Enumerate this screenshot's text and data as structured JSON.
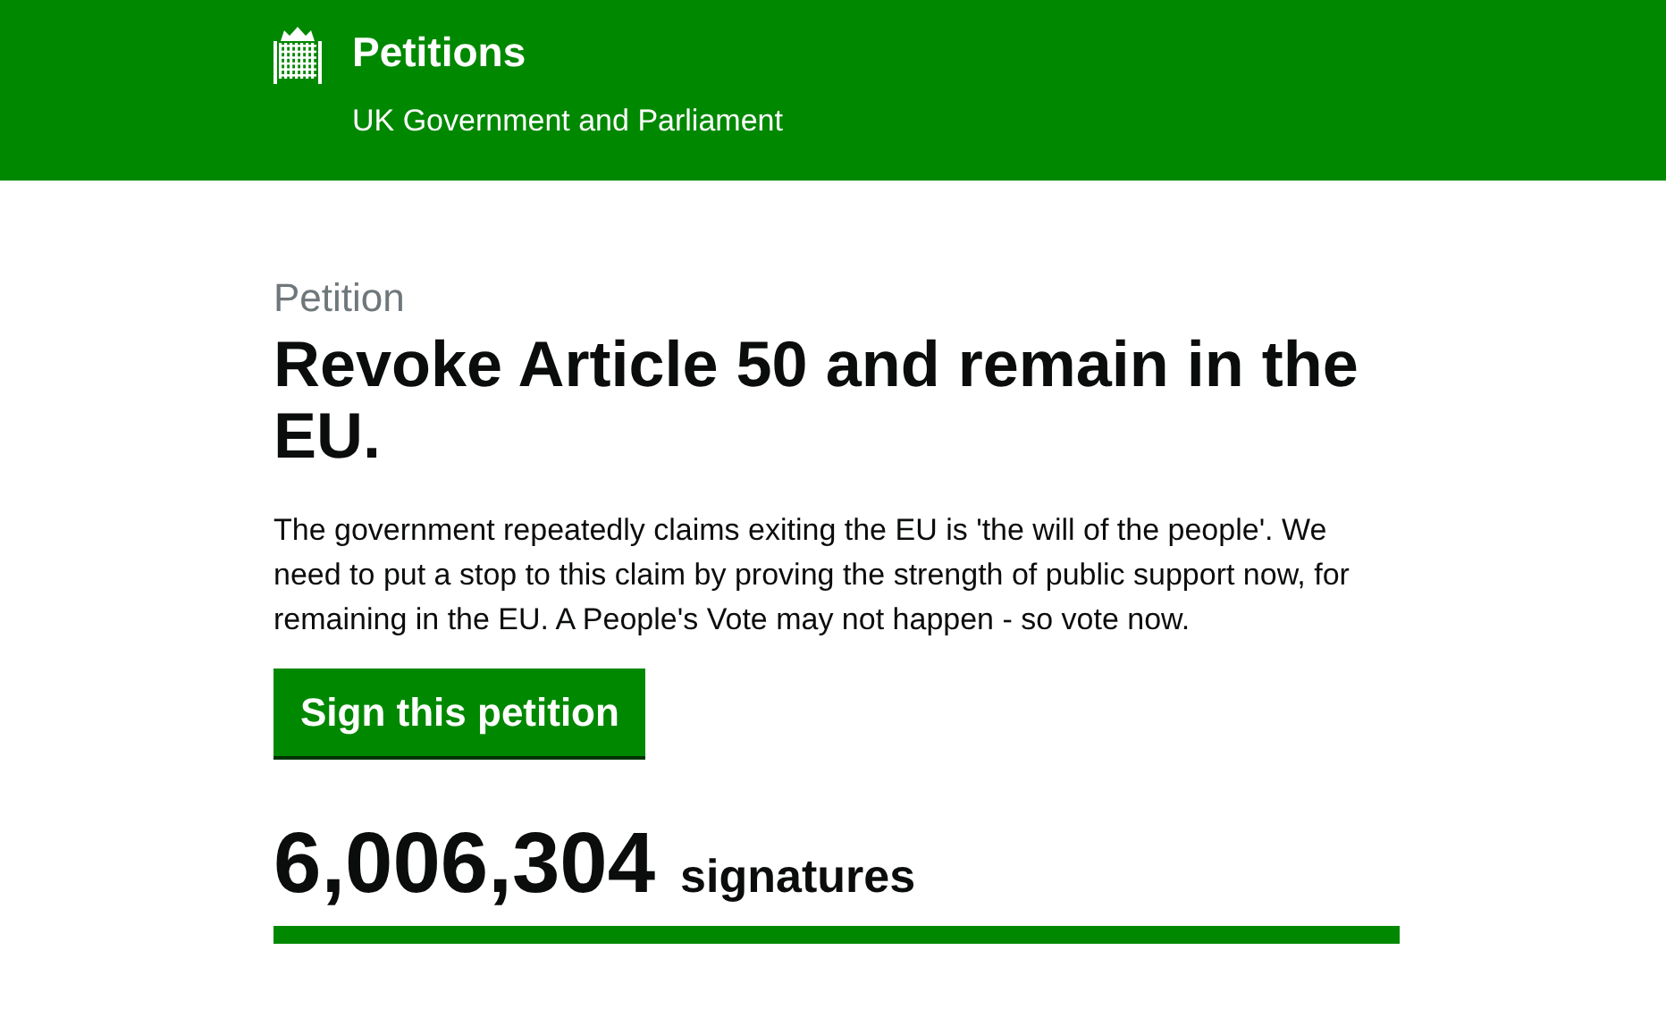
{
  "header": {
    "title": "Petitions",
    "subtitle": "UK Government and Parliament"
  },
  "petition": {
    "label": "Petition",
    "title": "Revoke Article 50 and remain in the EU.",
    "description": "The government repeatedly claims exiting the EU is 'the will of the people'. We need to put a stop to this claim by proving the strength of public support now, for remaining in the EU. A People's Vote may not happen - so vote now.",
    "sign_button": "Sign this petition",
    "signature_count": "6,006,304",
    "signature_label": "signatures",
    "progress": {
      "level": 1
    }
  }
}
